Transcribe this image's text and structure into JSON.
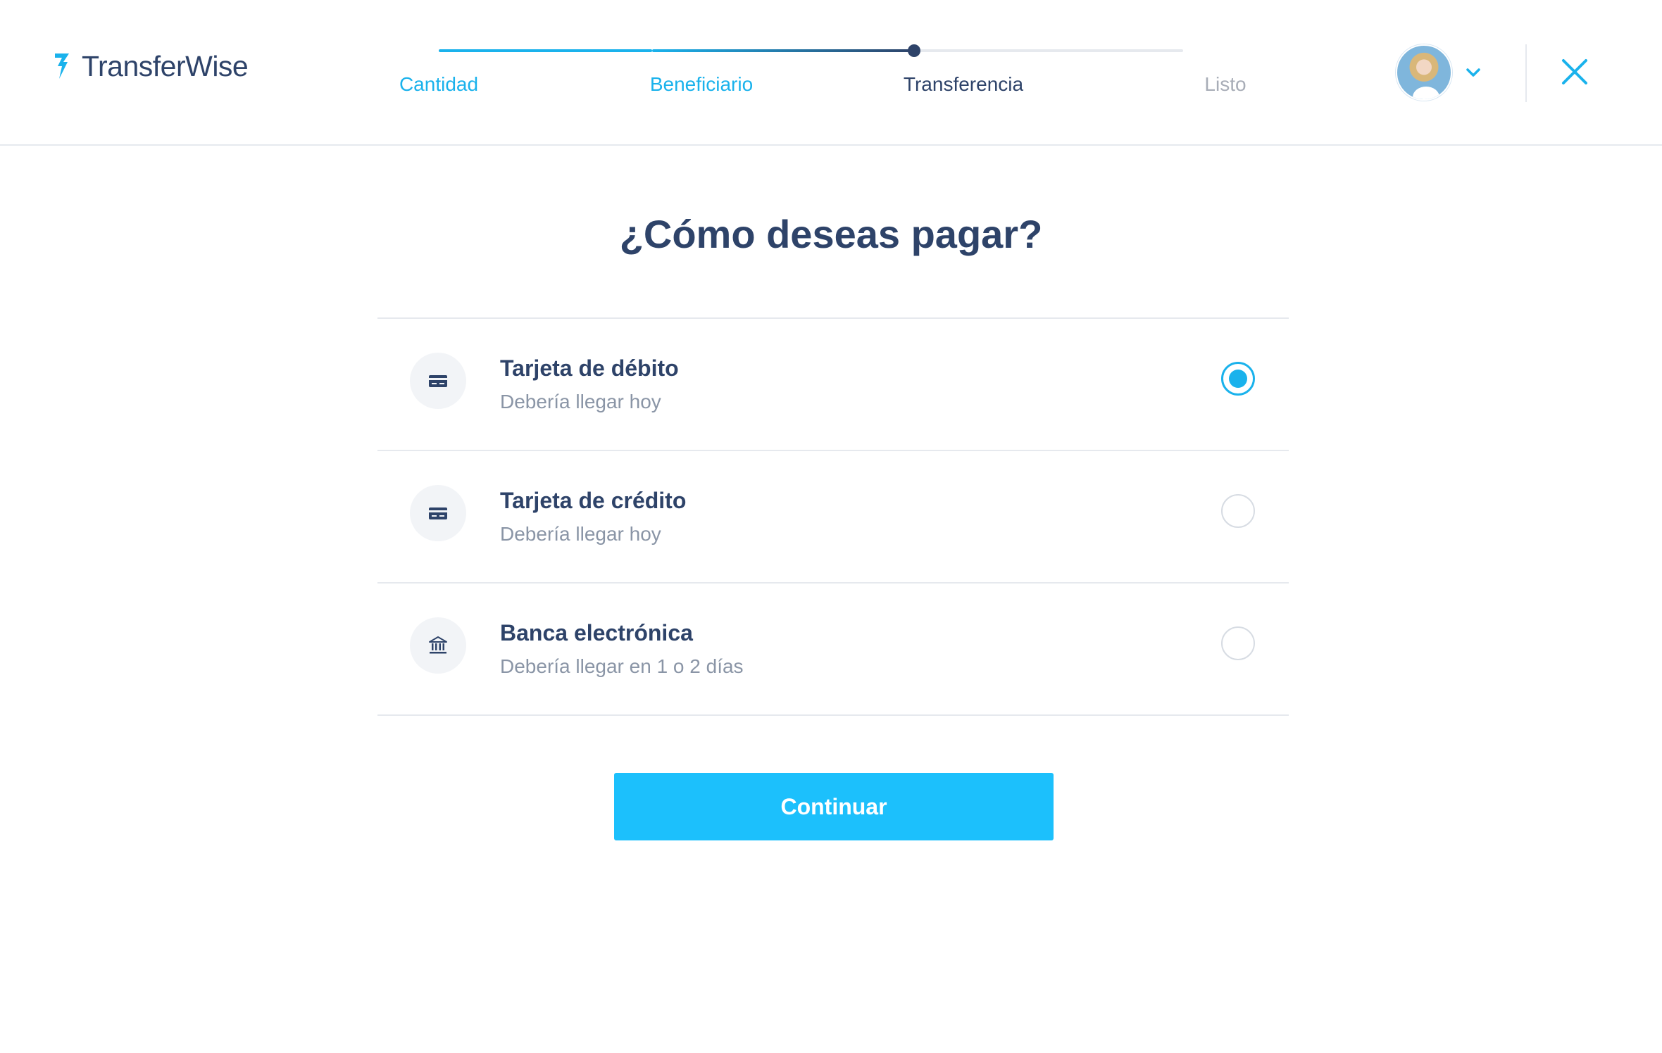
{
  "brand": {
    "name": "TransferWise",
    "accent": "#1ab2ec",
    "primary": "#2e4369"
  },
  "stepper": {
    "steps": [
      {
        "label": "Cantidad",
        "state": "done"
      },
      {
        "label": "Beneficiario",
        "state": "done"
      },
      {
        "label": "Transferencia",
        "state": "current"
      },
      {
        "label": "Listo",
        "state": "pending"
      }
    ]
  },
  "header": {
    "account_icon": "avatar",
    "dropdown_icon": "chevron-down-icon",
    "close_icon": "close-icon"
  },
  "main": {
    "title": "¿Cómo deseas pagar?",
    "options": [
      {
        "title": "Tarjeta de débito",
        "subtitle": "Debería llegar hoy",
        "icon": "credit-card-icon",
        "selected": true
      },
      {
        "title": "Tarjeta de crédito",
        "subtitle": "Debería llegar hoy",
        "icon": "credit-card-icon",
        "selected": false
      },
      {
        "title": "Banca electrónica",
        "subtitle": "Debería llegar en 1 o 2 días",
        "icon": "bank-icon",
        "selected": false
      }
    ],
    "continue_label": "Continuar"
  }
}
